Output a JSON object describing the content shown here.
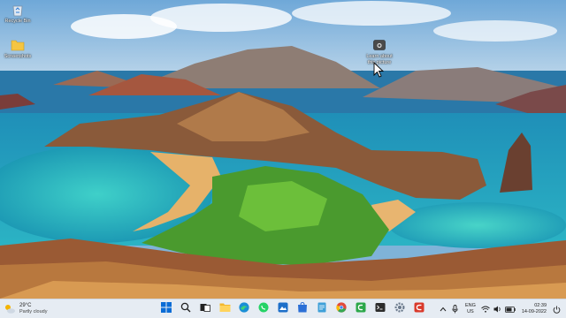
{
  "desktop": {
    "icons": [
      {
        "label": "Recycle Bin",
        "icon": "recycle-bin-icon"
      },
      {
        "label": "Screenshots",
        "icon": "folder-icon"
      },
      {
        "label": "Learn about\nthis picture",
        "icon": "camera-icon"
      }
    ]
  },
  "weather": {
    "temperature": "29°C",
    "condition": "Partly cloudy",
    "icon": "partly-cloudy-icon"
  },
  "taskbar": {
    "apps": [
      {
        "name": "start-icon",
        "color": "#0a6cd6"
      },
      {
        "name": "search-icon",
        "color": "#222222"
      },
      {
        "name": "task-view-icon",
        "color": "#222222"
      },
      {
        "name": "file-explorer-icon",
        "color": "#f3b72c"
      },
      {
        "name": "edge-icon",
        "color": "#1a8fd6"
      },
      {
        "name": "whatsapp-icon",
        "color": "#25d366"
      },
      {
        "name": "photos-icon",
        "color": "#1d6fc9"
      },
      {
        "name": "store-icon",
        "color": "#2b6fd6"
      },
      {
        "name": "notepad-icon",
        "color": "#3fa0d8"
      },
      {
        "name": "chrome-icon",
        "color": "#e04a3c"
      },
      {
        "name": "green-app-icon",
        "color": "#2ca84a"
      },
      {
        "name": "terminal-icon",
        "color": "#2c2c2c"
      },
      {
        "name": "settings-icon",
        "color": "#6b7a8c"
      },
      {
        "name": "red-app-icon",
        "color": "#d93a2b"
      }
    ]
  },
  "tray": {
    "chevron_icon": "chevron-up-icon",
    "mic_icon": "microphone-icon",
    "lang_line1": "ENG",
    "lang_line2": "US",
    "wifi_icon": "wifi-icon",
    "volume_icon": "volume-icon",
    "battery_icon": "battery-icon",
    "time": "02:39",
    "date": "14-09-2022",
    "power_icon": "power-icon"
  }
}
